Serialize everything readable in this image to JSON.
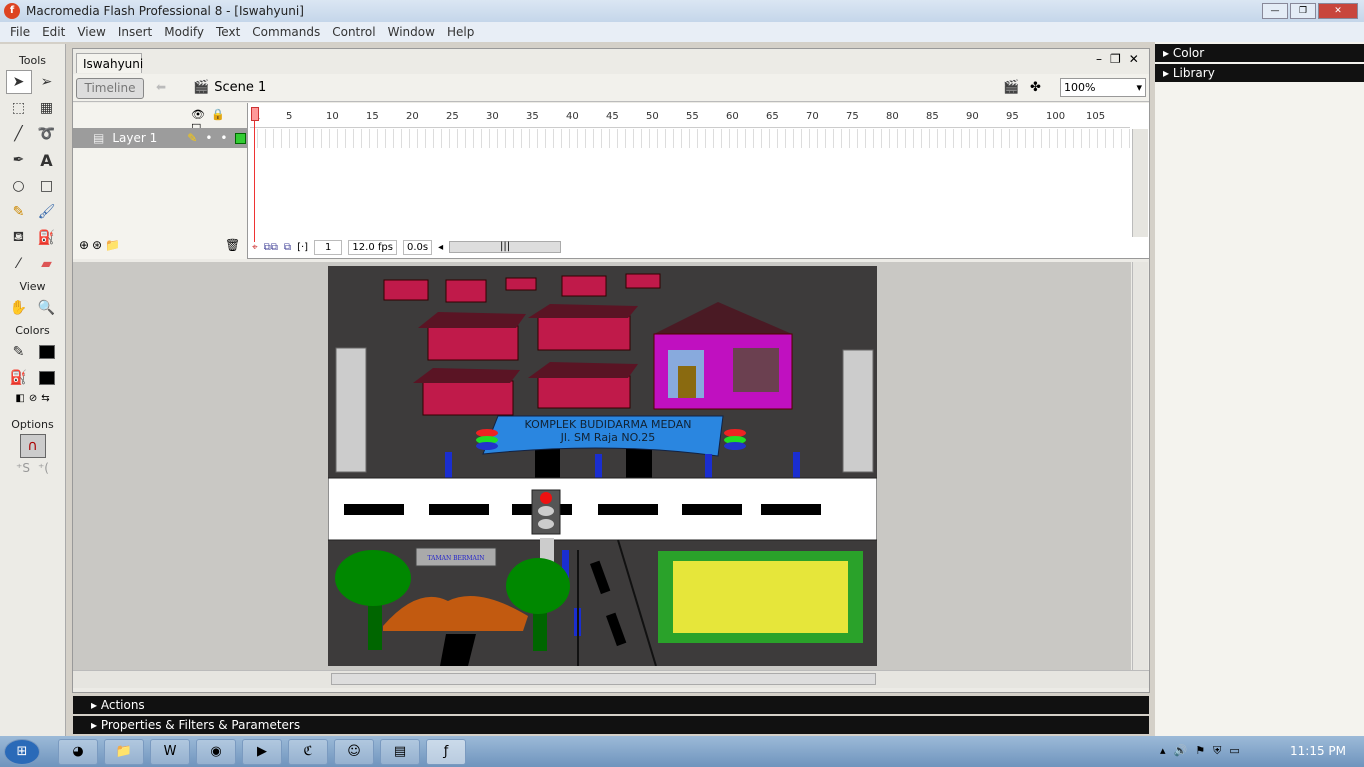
{
  "window": {
    "title": "Macromedia Flash Professional 8 - [Iswahyuni]"
  },
  "menu": [
    "File",
    "Edit",
    "View",
    "Insert",
    "Modify",
    "Text",
    "Commands",
    "Control",
    "Window",
    "Help"
  ],
  "tools": {
    "title": "Tools",
    "view": "View",
    "colors": "Colors",
    "options": "Options",
    "stroke_color": "#000000",
    "fill_color": "#000000"
  },
  "document": {
    "tab": "Iswahyuni",
    "timeline_button": "Timeline",
    "scene": "Scene 1",
    "zoom": "100%"
  },
  "timeline": {
    "layer": "Layer 1",
    "ruler": [
      1,
      5,
      10,
      15,
      20,
      25,
      30,
      35,
      40,
      45,
      50,
      55,
      60,
      65,
      70,
      75,
      80,
      85,
      90,
      95,
      100,
      105
    ],
    "current_frame": "1",
    "fps": "12.0 fps",
    "time": "0.0s"
  },
  "stage": {
    "sign_line1": "KOMPLEK BUDIDARMA MEDAN",
    "sign_line2": "Jl. SM Raja NO.25",
    "park_sign": "TAMAN BERMAIN"
  },
  "panels": {
    "color": "Color",
    "library": "Library",
    "actions": "Actions",
    "properties": "Properties & Filters & Parameters"
  },
  "taskbar": {
    "clock": "11:15 PM"
  }
}
